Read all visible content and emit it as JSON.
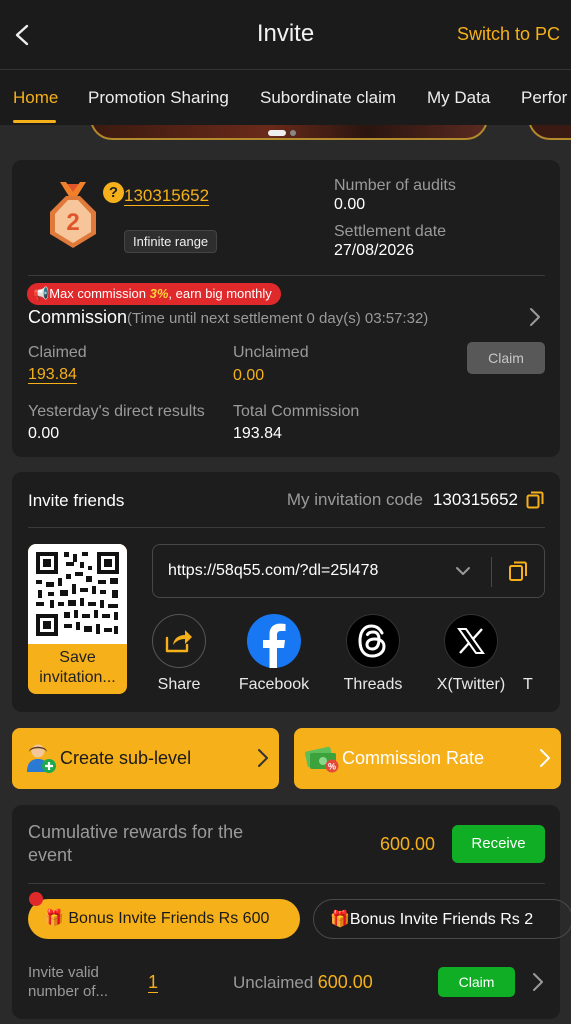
{
  "header": {
    "title": "Invite",
    "switch_label": "Switch to PC"
  },
  "tabs": [
    {
      "label": "Home",
      "active": true
    },
    {
      "label": "Promotion Sharing"
    },
    {
      "label": "Subordinate claim"
    },
    {
      "label": "My Data"
    },
    {
      "label": "Perfor"
    }
  ],
  "profile": {
    "level": "2",
    "user_id": "130315652",
    "range_tag": "Infinite range",
    "audits_label": "Number of audits",
    "audits_value": "0.00",
    "settlement_label": "Settlement date",
    "settlement_value": "27/08/2026"
  },
  "commission": {
    "promo_prefix": "Max commission ",
    "promo_highlight": "3%",
    "promo_suffix": ", earn big monthly",
    "title": "Commission",
    "countdown": "(Time until next settlement  0 day(s) 03:57:32)",
    "claimed_label": "Claimed",
    "claimed_value": "193.84",
    "unclaimed_label": "Unclaimed",
    "unclaimed_value": "0.00",
    "claim_button": "Claim",
    "yesterday_label": "Yesterday's direct results",
    "yesterday_value": "0.00",
    "total_label": "Total Commission",
    "total_value": "193.84"
  },
  "invite": {
    "title": "Invite friends",
    "code_label": "My invitation code",
    "code_value": "130315652",
    "qr_caption": "Save invitation...",
    "link": "https://58q55.com/?dl=25l478",
    "share": [
      {
        "label": "Share",
        "icon": "share-icon"
      },
      {
        "label": "Facebook",
        "icon": "facebook-icon"
      },
      {
        "label": "Threads",
        "icon": "threads-icon"
      },
      {
        "label": "X(Twitter)",
        "icon": "x-twitter-icon"
      },
      {
        "label": "T",
        "icon": ""
      }
    ]
  },
  "actions": {
    "create_sub_level": "Create sub-level",
    "commission_rate": "Commission Rate"
  },
  "event": {
    "cumulative_label": "Cumulative rewards for the event",
    "cumulative_value": "600.00",
    "receive_button": "Receive",
    "bonus_pills": [
      "Bonus Invite Friends Rs 600",
      "Bonus Invite Friends Rs 2"
    ],
    "valid_label": "Invite valid number of...",
    "valid_value": "1",
    "unclaimed_label": "Unclaimed",
    "unclaimed_value": "600.00",
    "claim_button": "Claim"
  },
  "colors": {
    "accent": "#f5b01a",
    "background": "#2a2a2a",
    "card": "#1d1d1d",
    "success": "#0fae24",
    "danger": "#e0292b"
  }
}
